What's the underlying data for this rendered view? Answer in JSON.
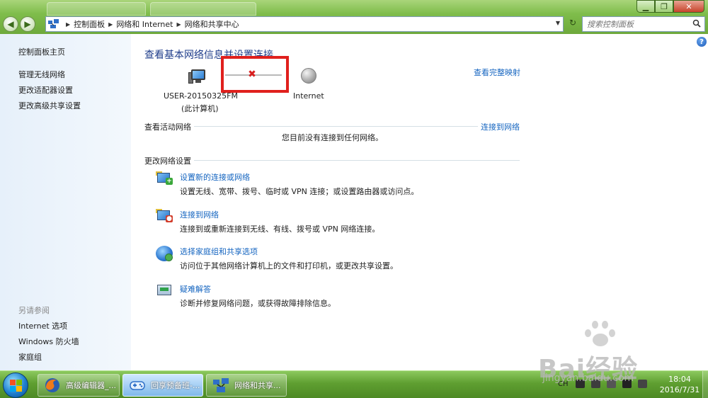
{
  "window": {
    "minimize": "▁",
    "maximize": "❐",
    "close": "✕"
  },
  "nav": {
    "back": "◀",
    "forward": "▶",
    "breadcrumbs": [
      "控制面板",
      "网络和 Internet",
      "网络和共享中心"
    ],
    "refresh": "↻",
    "search_placeholder": "搜索控制面板"
  },
  "sidebar": {
    "home": "控制面板主页",
    "links": [
      "管理无线网络",
      "更改适配器设置",
      "更改高级共享设置"
    ],
    "see_also_heading": "另请参阅",
    "see_also": [
      "Internet 选项",
      "Windows 防火墙",
      "家庭组"
    ]
  },
  "main": {
    "title": "查看基本网络信息并设置连接",
    "full_map": "查看完整映射",
    "computer_name": "USER-20150325FM",
    "computer_sub": "(此计算机)",
    "internet_label": "Internet",
    "active_networks_heading": "查看活动网络",
    "connect_link": "连接到网络",
    "no_network_msg": "您目前没有连接到任何网络。",
    "change_settings_heading": "更改网络设置",
    "tasks": [
      {
        "title": "设置新的连接或网络",
        "desc": "设置无线、宽带、拨号、临时或 VPN 连接；或设置路由器或访问点。"
      },
      {
        "title": "连接到网络",
        "desc": "连接到或重新连接到无线、有线、拨号或 VPN 网络连接。"
      },
      {
        "title": "选择家庭组和共享选项",
        "desc": "访问位于其他网络计算机上的文件和打印机，或更改共享设置。"
      },
      {
        "title": "疑难解答",
        "desc": "诊断并修复网络问题，或获得故障排除信息。"
      }
    ]
  },
  "taskbar": {
    "items": [
      {
        "label": "高级编辑器_..."
      },
      {
        "label": "回享预备班-..."
      },
      {
        "label": "网络和共享..."
      }
    ],
    "tray_lang": "CH",
    "clock_time": "18:04",
    "clock_date": "2016/7/31"
  },
  "watermark": {
    "brand": "Bai经验",
    "url": "jingyan.baidu.com"
  },
  "colors": {
    "link": "#1565c0",
    "title": "#1e3c8a",
    "frame": "#7fbd4b",
    "highlight": "#e0201d",
    "error_x": "#d81e1e"
  }
}
